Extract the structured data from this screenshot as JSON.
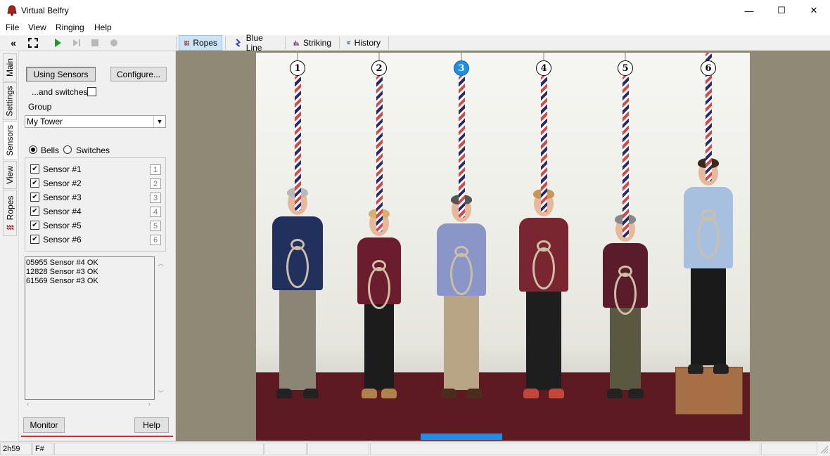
{
  "window": {
    "title": "Virtual Belfry",
    "controls": [
      "—",
      "☐",
      "✕"
    ]
  },
  "menu": [
    "File",
    "View",
    "Ringing",
    "Help"
  ],
  "toolbar": {
    "tabs": [
      {
        "label": "Ropes",
        "icon": "ropes-icon",
        "active": true
      },
      {
        "label": "Blue Line",
        "icon": "blue-line-icon",
        "active": false
      },
      {
        "label": "Striking",
        "icon": "striking-icon",
        "active": false
      },
      {
        "label": "History",
        "icon": "history-icon",
        "active": false
      }
    ]
  },
  "side_tabs": [
    "Main",
    "Settings",
    "Sensors",
    "View",
    "Ropes"
  ],
  "sensors_panel": {
    "using_sensors_label": "Using Sensors",
    "configure_label": "Configure...",
    "and_switches_label": "...and switches",
    "group_label": "Group",
    "group_value": "My Tower",
    "mode_bells_label": "Bells",
    "mode_switches_label": "Switches",
    "sensors": [
      {
        "label": "Sensor #1",
        "bell": "1",
        "checked": true
      },
      {
        "label": "Sensor #2",
        "bell": "2",
        "checked": true
      },
      {
        "label": "Sensor #3",
        "bell": "3",
        "checked": true
      },
      {
        "label": "Sensor #4",
        "bell": "4",
        "checked": true
      },
      {
        "label": "Sensor #5",
        "bell": "5",
        "checked": true
      },
      {
        "label": "Sensor #6",
        "bell": "6",
        "checked": true
      }
    ],
    "log": [
      "05955 Sensor #4  OK",
      "12828 Sensor #3  OK",
      "61569 Sensor #3  OK"
    ],
    "monitor_label": "Monitor",
    "help_label": "Help"
  },
  "bells": [
    {
      "number": "1",
      "current": false
    },
    {
      "number": "2",
      "current": false
    },
    {
      "number": "3",
      "current": true
    },
    {
      "number": "4",
      "current": false
    },
    {
      "number": "5",
      "current": false
    },
    {
      "number": "6",
      "current": false
    }
  ],
  "colors": {
    "accent": "#1e8fe6",
    "carpet": "#5e1a22",
    "stage": "#8f8a76"
  },
  "status": {
    "time": "2h59",
    "key": "F#"
  }
}
